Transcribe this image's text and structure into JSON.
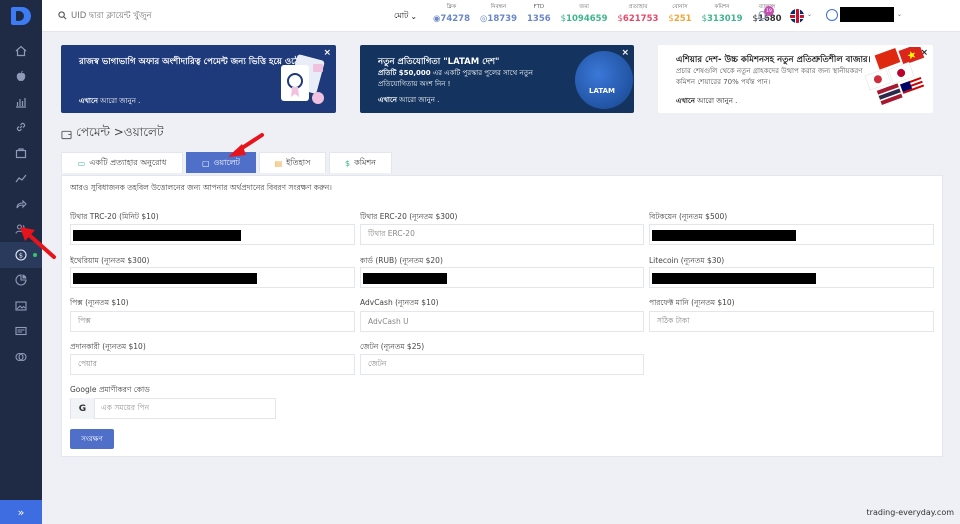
{
  "search": {
    "placeholder": "UID দ্বারা ক্লায়েন্ট খুঁজুন"
  },
  "period": {
    "label": "মোট"
  },
  "stats": [
    {
      "label": "ক্লিক",
      "value": "74278",
      "color": "#6a87c9",
      "icon": "eye-icon"
    },
    {
      "label": "নিবন্ধন",
      "value": "18739",
      "color": "#6a87c9",
      "icon": "user-icon"
    },
    {
      "label": "FTD",
      "value": "1356",
      "color": "#6a87c9",
      "icon": ""
    },
    {
      "label": "জমা",
      "value": "1094659",
      "color": "#3fb58c",
      "icon": "dollar-icon"
    },
    {
      "label": "প্রত্যাহার",
      "value": "621753",
      "color": "#e24a6a",
      "icon": "dollar-icon"
    },
    {
      "label": "বোনাস",
      "value": "251",
      "color": "#f0a43a",
      "icon": "dollar-icon"
    },
    {
      "label": "কমিশন",
      "value": "313019",
      "color": "#3fb58c",
      "icon": "dollar-icon"
    },
    {
      "label": "ব্যালান্স",
      "value": "1680",
      "color": "#333333",
      "icon": "dollar-icon"
    }
  ],
  "notifications": {
    "count": "19"
  },
  "banners": [
    {
      "title": "রাজস্ব ভাগাভাগি অফার অংশীদারিত্ব পেমেন্ট জন্য ভিত্তি হয়ে ওঠে",
      "subtitle": "",
      "more_bold": "এখানে",
      "more_rest": " আরো জানুন ."
    },
    {
      "title": "নতুন প্রতিযোগিতা \"LATAM দেশ\"",
      "subtitle_bold": "প্রতিটি $50,000",
      "subtitle": " এর একটি পুরস্কার পুলের সাথে নতুন প্রতিযোগিতায় অংশ নিন !",
      "more_bold": "এখানে",
      "more_rest": " আরো জানুন .",
      "globe_label": "LATAM"
    },
    {
      "title": "এশিয়ার দেশ- উচ্চ কমিশনসহ নতুন প্রতিশ্রুতিশীল বাজার।",
      "subtitle": "প্রচার শেষগুলি থেকে নতুন গ্রাহকদের উত্থাপ করার জন্য স্থানীয়করণ কমিশন শেয়ারের 70% পর্যন্ত পান।",
      "more_bold": "এখানে",
      "more_rest": " আরো জানুন ."
    }
  ],
  "page": {
    "title": "পেমেন্ট >ওয়ালেট"
  },
  "tabs": [
    {
      "label": "একটি প্রত্যাহার অনুরোধ",
      "icon": "money-icon"
    },
    {
      "label": "ওয়ালেট",
      "icon": "wallet-icon"
    },
    {
      "label": "ইতিহাস",
      "icon": "history-icon"
    },
    {
      "label": "কমিশন",
      "icon": "dollar-icon"
    }
  ],
  "wallet": {
    "hint": "আরও সুবিধাজনক তহবিল উত্তোলনের জন্য আপনার অর্থপ্রদানের বিবরণ সংরক্ষণ করুন।",
    "fields": [
      {
        "label": "টিথার TRC-20 (মিনিট $10)",
        "placeholder": "",
        "redacted": true
      },
      {
        "label": "টিথার ERC-20 (ন্যূনতম $300)",
        "placeholder": "টিথার ERC-20",
        "redacted": false
      },
      {
        "label": "বিটকয়েন (ন্যূনতম $500)",
        "placeholder": "",
        "redacted": true
      },
      {
        "label": "ইথেরিয়াম (ন্যূনতম $300)",
        "placeholder": "",
        "redacted": true
      },
      {
        "label": "কার্ড (RUB) (ন্যূনতম $20)",
        "placeholder": "",
        "redacted": true
      },
      {
        "label": "Litecoin (ন্যূনতম $30)",
        "placeholder": "",
        "redacted": true
      },
      {
        "label": "পিক্স (ন্যূনতম $10)",
        "placeholder": "পিক্স",
        "redacted": false
      },
      {
        "label": "AdvCash (ন্যূনতম $10)",
        "placeholder": "AdvCash U",
        "redacted": false
      },
      {
        "label": "পারফেক্ট মানি (ন্যূনতম $10)",
        "placeholder": "সঠিক টাকা",
        "redacted": false
      },
      {
        "label": "প্রদানকারী (ন্যূনতম $10)",
        "placeholder": "পেয়ার",
        "redacted": false
      },
      {
        "label": "জেটন (ন্যূনতম $25)",
        "placeholder": "জেটন",
        "redacted": false
      }
    ],
    "google_label": "Google প্রমাণীকরণ কোড",
    "google_prefix": "G",
    "google_placeholder": "এক সময়ের পিন",
    "save_label": "সংরক্ষণ"
  },
  "watermark": "trading-everyday.com",
  "colors": {
    "sidebar": "#1f2a44",
    "accent": "#4f6fc9",
    "arrow": "#e8141c"
  }
}
